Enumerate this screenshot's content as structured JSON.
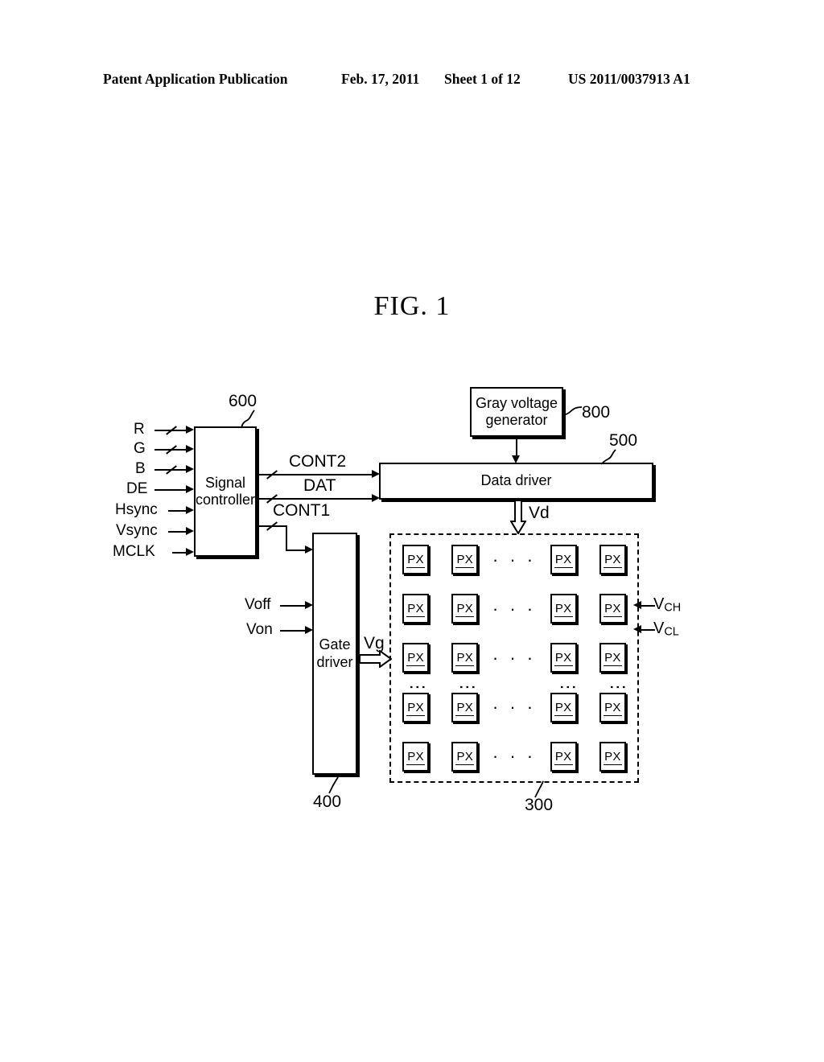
{
  "header": {
    "publication": "Patent Application Publication",
    "date": "Feb. 17, 2011",
    "sheet": "Sheet 1 of 12",
    "number": "US 2011/0037913 A1"
  },
  "figure": {
    "title": "FIG. 1"
  },
  "blocks": {
    "signal_controller": {
      "line1": "Signal",
      "line2": "controller",
      "ref": "600"
    },
    "gray_voltage_generator": {
      "line1": "Gray voltage",
      "line2": "generator",
      "ref": "800"
    },
    "data_driver": {
      "line1": "Data driver",
      "ref": "500"
    },
    "gate_driver": {
      "line1": "Gate",
      "line2": "driver",
      "ref": "400"
    },
    "pixel_array": {
      "ref": "300",
      "cell_label": "PX"
    }
  },
  "inputs": {
    "controller": [
      {
        "label": "R",
        "bus": true
      },
      {
        "label": "G",
        "bus": true
      },
      {
        "label": "B",
        "bus": true
      },
      {
        "label": "DE",
        "bus": false
      },
      {
        "label": "Hsync",
        "bus": false
      },
      {
        "label": "Vsync",
        "bus": false
      },
      {
        "label": "MCLK",
        "bus": false
      }
    ],
    "gate_driver": [
      {
        "label": "Voff"
      },
      {
        "label": "Von"
      }
    ]
  },
  "signals": {
    "cont2": "CONT2",
    "dat": "DAT",
    "cont1": "CONT1",
    "vd": "Vd",
    "vg": "Vg",
    "vch": "V",
    "vch_sub": "CH",
    "vcl": "V",
    "vcl_sub": "CL"
  },
  "array": {
    "rows": [
      [
        "PX",
        "PX",
        "hdots",
        "PX",
        "PX"
      ],
      [
        "PX",
        "PX",
        "hdots",
        "PX",
        "PX"
      ],
      [
        "PX",
        "PX",
        "hdots",
        "PX",
        "PX"
      ],
      [
        "vdots",
        "vdots",
        "blank",
        "vdots",
        "vdots"
      ],
      [
        "PX",
        "PX",
        "hdots",
        "PX",
        "PX"
      ],
      [
        "PX",
        "PX",
        "hdots",
        "PX",
        "PX"
      ]
    ],
    "hdots_glyph": "· · ·",
    "vdots_glyph": "⋮"
  },
  "colors": {
    "ink": "#000000",
    "paper": "#ffffff"
  }
}
